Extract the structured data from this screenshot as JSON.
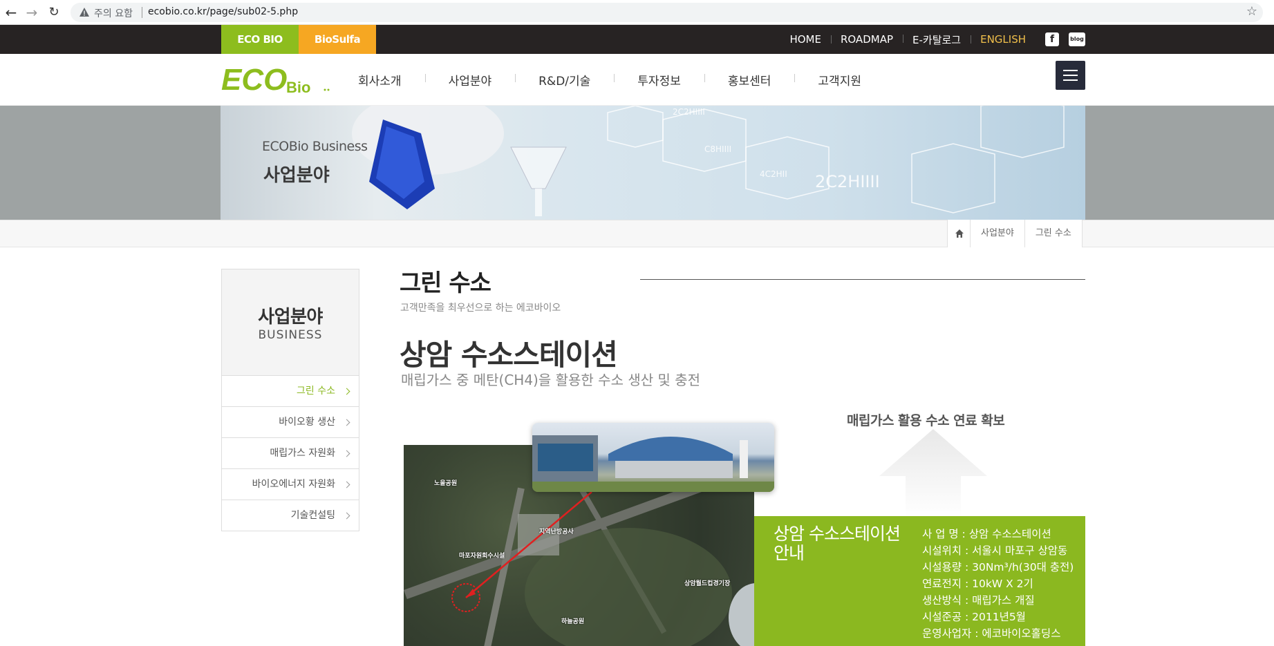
{
  "browser": {
    "warning_text": "주의 요함",
    "url": "ecobio.co.kr/page/sub02-5.php"
  },
  "topbar": {
    "site_tabs": [
      "ECO BIO",
      "BioSulfa"
    ],
    "links": [
      "HOME",
      "ROADMAP",
      "E-카탈로그",
      "ENGLISH"
    ],
    "social": {
      "facebook": "f",
      "blog": "blog"
    },
    "accent_colors": {
      "eco": "#8dbd1e",
      "biosulfa": "#f6a722",
      "english": "#f1c04b"
    }
  },
  "header": {
    "logo_main": "ECO",
    "logo_sub": "Bio",
    "nav": [
      "회사소개",
      "사업분야",
      "R&D/기술",
      "투자정보",
      "홍보센터",
      "고객지원"
    ]
  },
  "banner": {
    "subtitle": "ECOBio Business",
    "title": "사업분야",
    "hex_labels": [
      "2C2HIIII",
      "C8HIIII",
      "4C2HII",
      "2C2HIIII"
    ]
  },
  "breadcrumb": [
    "사업분야",
    "그린 수소"
  ],
  "sidebar": {
    "title_ko": "사업분야",
    "title_en": "BUSINESS",
    "items": [
      "그린 수소",
      "바이오황 생산",
      "매립가스 자원화",
      "바이오에너지 자원화",
      "기술컨설팅"
    ],
    "active_index": 0
  },
  "content": {
    "page_title": "그린 수소",
    "page_subtitle": "고객만족을 최우선으로 하는 에코바이오",
    "section_title": "상암 수소스테이션",
    "section_subtitle": "매립가스 중 메탄(CH4)을 활용한 수소 생산 및 충전",
    "arrow_caption": "매립가스 활용 수소 연료 확보",
    "map_labels": [
      "노을공원",
      "지역난방공사",
      "마포자원회수시설",
      "상암월드컵경기장",
      "하늘공원"
    ],
    "info": {
      "name": "상암 수소스테이션 안내",
      "rows": [
        "사 업 명 : 상암 수소스테이션",
        "시설위치 : 서울시 마포구 상암동",
        "시설용량 : 30Nm³/h(30대 충전)",
        "연료전지 : 10kW X 2기",
        "생산방식 : 매립가스 개질",
        "시설준공 : 2011년5월",
        "운영사업자 : 에코바이오홀딩스"
      ]
    }
  }
}
